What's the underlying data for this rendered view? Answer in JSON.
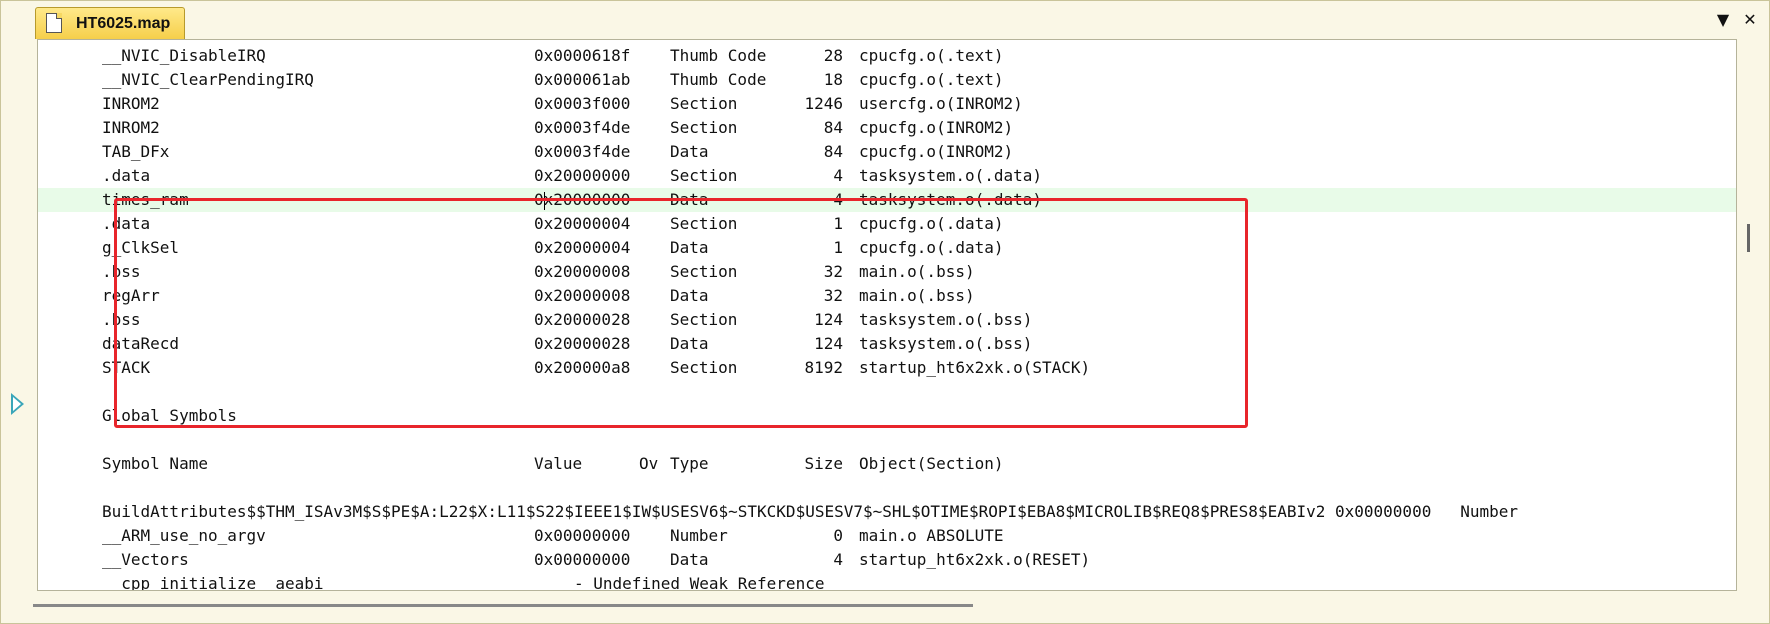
{
  "tab": {
    "title": "HT6025.map"
  },
  "controls": {
    "dropdown": "▼",
    "close": "✕"
  },
  "lines": [
    {
      "name": "__NVIC_DisableIRQ",
      "value": "0x0000618f",
      "type": "Thumb Code",
      "size": "28",
      "object": "cpucfg.o(.text)"
    },
    {
      "name": "__NVIC_ClearPendingIRQ",
      "value": "0x000061ab",
      "type": "Thumb Code",
      "size": "18",
      "object": "cpucfg.o(.text)"
    },
    {
      "name": "INROM2",
      "value": "0x0003f000",
      "type": "Section",
      "size": "1246",
      "object": "usercfg.o(INROM2)"
    },
    {
      "name": "INROM2",
      "value": "0x0003f4de",
      "type": "Section",
      "size": "84",
      "object": "cpucfg.o(INROM2)"
    },
    {
      "name": "TAB_DFx",
      "value": "0x0003f4de",
      "type": "Data",
      "size": "84",
      "object": "cpucfg.o(INROM2)"
    },
    {
      "name": ".data",
      "value": "0x20000000",
      "type": "Section",
      "size": "4",
      "object": "tasksystem.o(.data)"
    },
    {
      "name": "times_ram",
      "value_pre": "0",
      "value_post": "x20000000",
      "type": "Data",
      "size": "4",
      "object": "tasksystem.o(.data)"
    },
    {
      "name": ".data",
      "value": "0x20000004",
      "type": "Section",
      "size": "1",
      "object": "cpucfg.o(.data)"
    },
    {
      "name": "g_ClkSel",
      "value": "0x20000004",
      "type": "Data",
      "size": "1",
      "object": "cpucfg.o(.data)"
    },
    {
      "name": ".bss",
      "value": "0x20000008",
      "type": "Section",
      "size": "32",
      "object": "main.o(.bss)"
    },
    {
      "name": "regArr",
      "value": "0x20000008",
      "type": "Data",
      "size": "32",
      "object": "main.o(.bss)"
    },
    {
      "name": ".bss",
      "value": "0x20000028",
      "type": "Section",
      "size": "124",
      "object": "tasksystem.o(.bss)"
    },
    {
      "name": "dataRecd",
      "value": "0x20000028",
      "type": "Data",
      "size": "124",
      "object": "tasksystem.o(.bss)"
    },
    {
      "name": "STACK",
      "value": "0x200000a8",
      "type": "Section",
      "size": "8192",
      "object": "startup_ht6x2xk.o(STACK)"
    }
  ],
  "global": {
    "heading": "Global Symbols",
    "header": {
      "name": "Symbol Name",
      "value": "Value",
      "ov": "Ov",
      "type": "Type",
      "size": "Size",
      "object": "Object(Section)"
    },
    "build_attr": "BuildAttributes$$THM_ISAv3M$S$PE$A:L22$X:L11$S22$IEEE1$IW$USESV6$~STKCKD$USESV7$~SHL$OTIME$ROPI$EBA8$MICROLIB$REQ8$PRES8$EABIv2 0x00000000   Number",
    "rows": [
      {
        "name": "__ARM_use_no_argv",
        "value": "0x00000000",
        "type": "Number",
        "size": "0",
        "object": "main.o ABSOLUTE"
      },
      {
        "name": "__Vectors",
        "value": "0x00000000",
        "type": "Data",
        "size": "4",
        "object": "startup_ht6x2xk.o(RESET)"
      }
    ],
    "partial": "  cpp initialize  aeabi                          - Undefined Weak Reference"
  }
}
